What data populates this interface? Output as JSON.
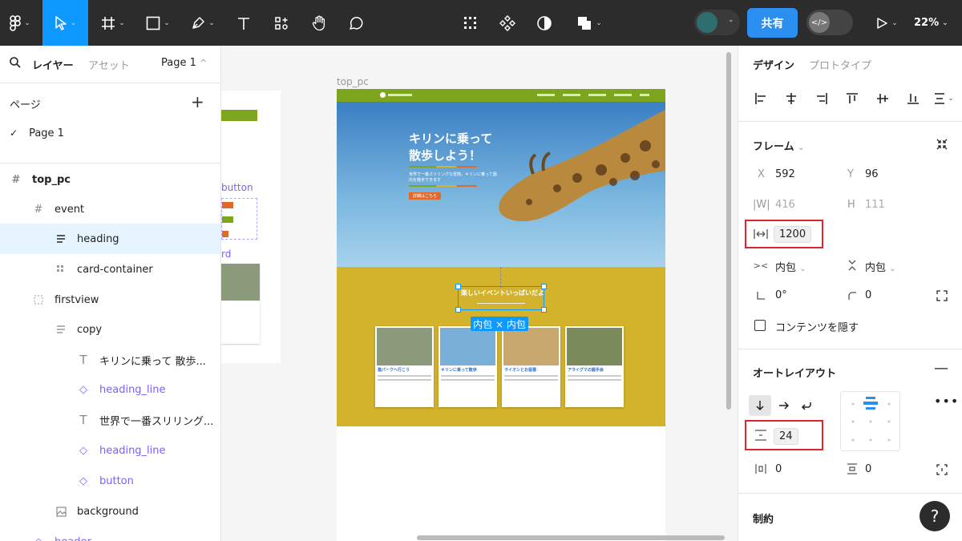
{
  "toolbar": {
    "share_label": "共有",
    "zoom_label": "22%"
  },
  "left_panel": {
    "tabs": {
      "layers": "レイヤー",
      "assets": "アセット",
      "page_select": "Page 1"
    },
    "pages_header": "ページ",
    "pages": [
      {
        "name": "Page 1",
        "selected": true
      }
    ],
    "layers": [
      {
        "name": "top_pc",
        "type": "frame"
      },
      {
        "name": "event",
        "type": "frame"
      },
      {
        "name": "heading",
        "type": "text-stack"
      },
      {
        "name": "card-container",
        "type": "grid"
      },
      {
        "name": "firstview",
        "type": "frame-dashed"
      },
      {
        "name": "copy",
        "type": "text-stack"
      },
      {
        "name": "キリンに乗って 散歩...",
        "type": "text"
      },
      {
        "name": "heading_line",
        "type": "component"
      },
      {
        "name": "世界で一番スリリング...",
        "type": "text"
      },
      {
        "name": "heading_line",
        "type": "component"
      },
      {
        "name": "button",
        "type": "component"
      },
      {
        "name": "background",
        "type": "image"
      },
      {
        "name": "header",
        "type": "component"
      }
    ]
  },
  "canvas": {
    "frame_label": "top_pc",
    "hero_title": "キリンに乗って\n散歩しよう！",
    "hero_subtitle": "世界で一番スリリングな冒険。キリンに乗って園内を散歩できます",
    "hero_button": "詳細はこちら",
    "event_heading": "楽しいイベントいっぱいだよ",
    "selection_badge": "内包 × 内包",
    "bg_button_text": "button",
    "bg_card_text": "rd",
    "cards": [
      {
        "title": "猫パークへ行こう",
        "color": "#8a9a7a"
      },
      {
        "title": "キリンに乗って散歩",
        "color": "#7ab0d8"
      },
      {
        "title": "ライオンとお昼寝",
        "color": "#c9a870"
      },
      {
        "title": "アライグマの握手会",
        "color": "#7a8a5a"
      }
    ]
  },
  "right_panel": {
    "tabs": {
      "design": "デザイン",
      "prototype": "プロトタイプ"
    },
    "frame_section": "フレーム",
    "x_label": "X",
    "x_value": "592",
    "y_label": "Y",
    "y_value": "96",
    "w_label": "|W|",
    "w_value": "416",
    "h_label": "H",
    "h_value": "111",
    "min_width_value": "1200",
    "hug_h": "内包",
    "hug_v": "内包",
    "rotation": "0°",
    "radius": "0",
    "clip_content": "コンテンツを隠す",
    "autolayout_section": "オートレイアウト",
    "gap_value": "24",
    "padding_h": "0",
    "padding_v": "0",
    "constraints_section": "制約",
    "help": "?"
  },
  "colors": {
    "accent": "#0d99ff",
    "share": "#2b8ff2",
    "highlight_red": "#e0242b",
    "header_green": "#7ea51e",
    "event_yellow": "#d4b32c"
  }
}
